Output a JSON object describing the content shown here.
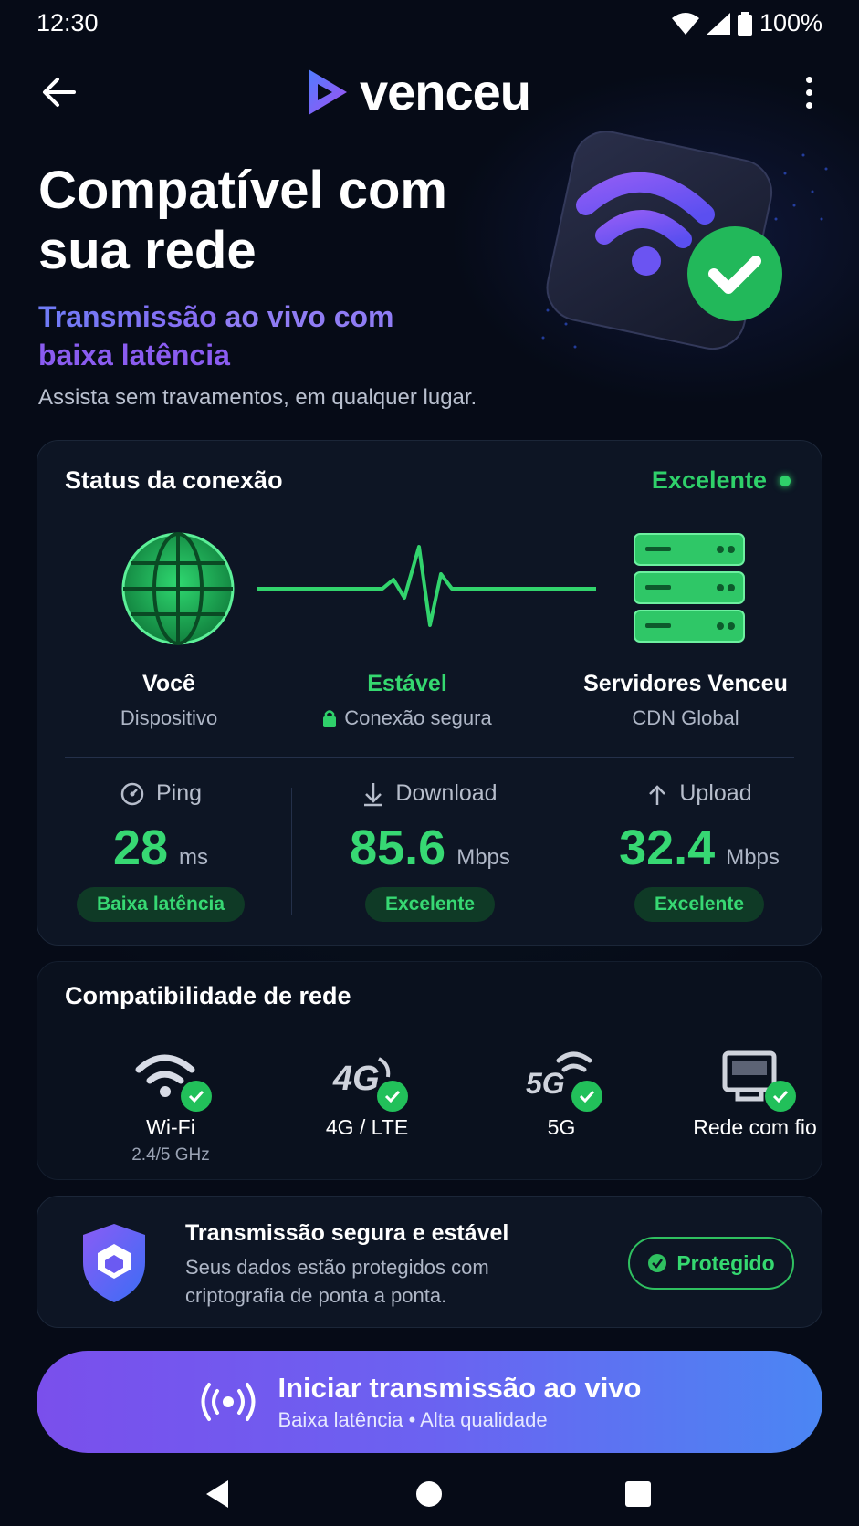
{
  "statusbar": {
    "time": "12:30",
    "battery": "100%"
  },
  "app": {
    "logo_text": "venceu"
  },
  "hero": {
    "title": "Compatível com sua rede",
    "subtitle_part1": "Transmissão",
    "subtitle_part2": " ao vivo com",
    "subtitle_part3": "baixa latência",
    "description": "Assista sem travamentos, em qualquer lugar."
  },
  "status_card": {
    "title": "Status da conexão",
    "status": "Excelente",
    "nodes": [
      {
        "label": "Você",
        "sub": "Dispositivo"
      },
      {
        "label": "Estável",
        "sub": "Conexão segura"
      },
      {
        "label": "Servidores Venceu",
        "sub": "CDN Global"
      }
    ],
    "metrics": [
      {
        "label": "Ping",
        "value": "28",
        "unit": "ms",
        "badge": "Baixa latência"
      },
      {
        "label": "Download",
        "value": "85.6",
        "unit": "Mbps",
        "badge": "Excelente"
      },
      {
        "label": "Upload",
        "value": "32.4",
        "unit": "Mbps",
        "badge": "Excelente"
      }
    ]
  },
  "compat_card": {
    "title": "Compatibilidade de rede",
    "items": [
      {
        "label": "Wi-Fi",
        "sub": "2.4/5 GHz",
        "icon": "wifi-icon"
      },
      {
        "label": "4G / LTE",
        "sub": "",
        "icon": "4g-icon"
      },
      {
        "label": "5G",
        "sub": "",
        "icon": "5g-icon"
      },
      {
        "label": "Rede com fio",
        "sub": "",
        "icon": "wired-network-icon"
      }
    ]
  },
  "secure_card": {
    "title": "Transmissão segura e estável",
    "description": "Seus dados estão protegidos com criptografia de ponta a ponta.",
    "badge": "Protegido"
  },
  "cta": {
    "title": "Iniciar transmissão ao vivo",
    "subtitle": "Baixa latência • Alta qualidade"
  },
  "colors": {
    "accent_green": "#2fd06a",
    "accent_purple": "#7a4fec",
    "accent_blue": "#4b86f3",
    "background": "#060b17"
  }
}
